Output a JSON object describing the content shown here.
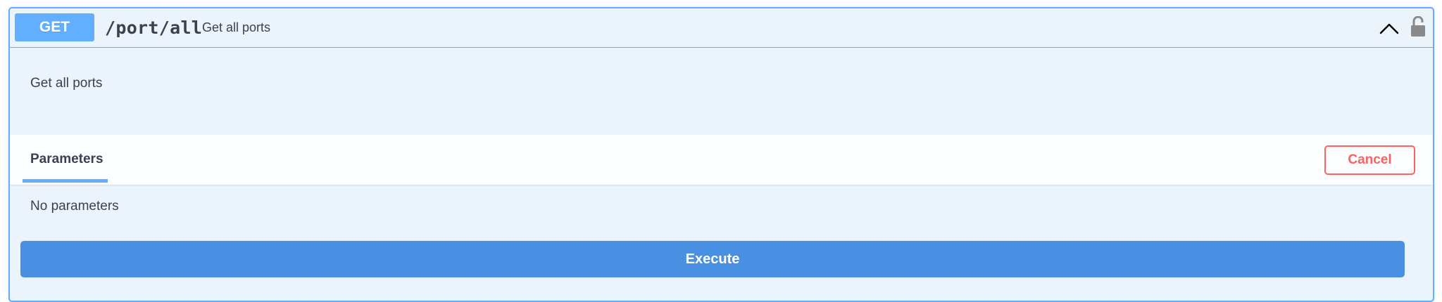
{
  "operation": {
    "method": "GET",
    "path": "/port/all",
    "summary": "Get all ports",
    "description": "Get all ports"
  },
  "icons": {
    "collapse": "chevron-up-icon",
    "auth": "unlocked-padlock-icon"
  },
  "parameters": {
    "tab_label": "Parameters",
    "cancel_label": "Cancel",
    "empty_text": "No parameters"
  },
  "actions": {
    "execute_label": "Execute"
  },
  "colors": {
    "get_accent": "#61affe",
    "block_background": "#ebf3fb",
    "cancel": "#ff6060",
    "execute": "#4990e2",
    "text": "#3b4151"
  }
}
